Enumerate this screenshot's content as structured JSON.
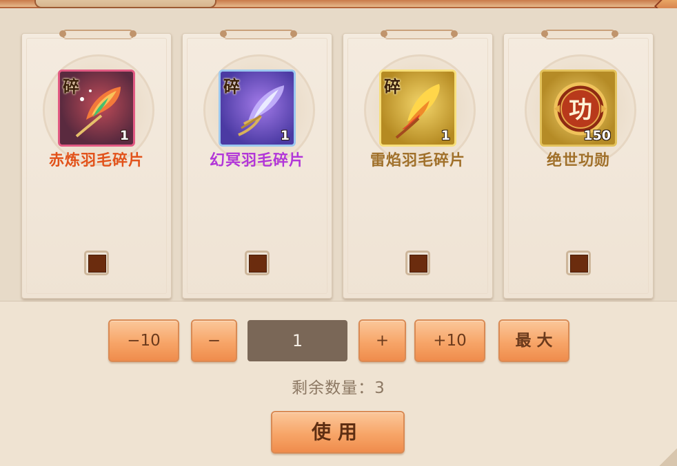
{
  "items": [
    {
      "name": "赤炼羽毛碎片",
      "shard_label": "碎",
      "count": "1",
      "name_color": "#e2521a",
      "frame": "red",
      "icon": "red-feather-icon"
    },
    {
      "name": "幻冥羽毛碎片",
      "shard_label": "碎",
      "count": "1",
      "name_color": "#b236d8",
      "frame": "purple",
      "icon": "purple-feather-icon"
    },
    {
      "name": "雷焰羽毛碎片",
      "shard_label": "碎",
      "count": "1",
      "name_color": "#a0702a",
      "frame": "gold",
      "icon": "golden-feather-icon"
    },
    {
      "name": "绝世功勋",
      "shard_label": "",
      "count": "150",
      "name_color": "#a0702a",
      "frame": "gold2",
      "icon": "merit-medal-icon",
      "medal_char": "功"
    }
  ],
  "controls": {
    "minus10_label": "−10",
    "minus_label": "−",
    "quantity_value": "1",
    "plus_label": "+",
    "plus10_label": "+10",
    "max_label": "最 大"
  },
  "remaining_text": "剩余数量：3",
  "use_label": "使用"
}
